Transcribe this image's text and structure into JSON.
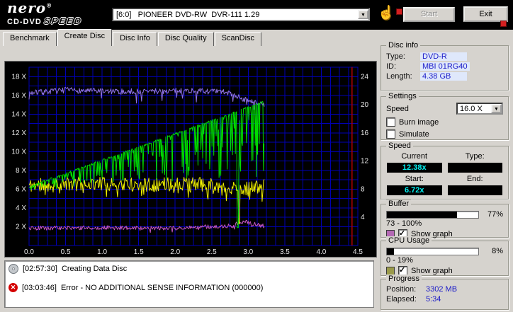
{
  "banner": {
    "logo_nero": "nero",
    "logo_reg": "®",
    "logo_sub1": "CD-DVD",
    "logo_sub2": "SPEED",
    "drive_selector": "[6:0]   PIONEER DVD-RW  DVR-111 1.29",
    "dropdown_glyph": "▼",
    "start_label": "Start",
    "exit_label": "Exit"
  },
  "tabs": [
    {
      "label": "Benchmark",
      "active": false
    },
    {
      "label": "Create Disc",
      "active": true
    },
    {
      "label": "Disc Info",
      "active": false
    },
    {
      "label": "Disc Quality",
      "active": false
    },
    {
      "label": "ScanDisc",
      "active": false
    }
  ],
  "chart_data": {
    "type": "line",
    "xlim": [
      0,
      4.5
    ],
    "ylim_left": [
      0,
      19
    ],
    "right_scale": 0.75,
    "x_ticks": [
      0,
      0.5,
      1,
      1.5,
      2,
      2.5,
      3,
      3.5,
      4,
      4.5
    ],
    "y_ticks_left": [
      {
        "v": 18,
        "label": "18 X"
      },
      {
        "v": 16,
        "label": "16 X"
      },
      {
        "v": 14,
        "label": "14 X"
      },
      {
        "v": 12,
        "label": "12 X"
      },
      {
        "v": 10,
        "label": "10 X"
      },
      {
        "v": 8,
        "label": "8 X"
      },
      {
        "v": 6,
        "label": "6 X"
      },
      {
        "v": 4,
        "label": "4 X"
      },
      {
        "v": 2,
        "label": "2 X"
      }
    ],
    "y_ticks_right": [
      {
        "v": 24,
        "label": "24"
      },
      {
        "v": 20,
        "label": "20"
      },
      {
        "v": 16,
        "label": "16"
      },
      {
        "v": 12,
        "label": "12"
      },
      {
        "v": 8,
        "label": "8"
      },
      {
        "v": 4,
        "label": "4"
      }
    ],
    "grid": {
      "color": "#0000b4",
      "x_step": 0.125,
      "y_step": 1
    },
    "end_marker": {
      "x": 4.42,
      "color": "#b40000"
    },
    "series": [
      {
        "name": "buffer-graph",
        "color": "#8f72e6",
        "seed": 7,
        "step": 0.01,
        "jitter": 0.3,
        "spike_prob": 0.07,
        "spike_depth": [
          0.4,
          1.8
        ],
        "keypoints": [
          [
            0,
            16.25
          ],
          [
            0.5,
            16.55
          ],
          [
            1.2,
            16.4
          ],
          [
            2.2,
            16.5
          ],
          [
            2.7,
            16.35
          ],
          [
            3.0,
            15.4
          ],
          [
            3.22,
            14.9
          ]
        ]
      },
      {
        "name": "aux-graph",
        "color": "#c255c2",
        "seed": 5,
        "step": 0.01,
        "jitter": 0.22,
        "spike_prob": 0.05,
        "spike_depth": [
          0.1,
          0.5
        ],
        "keypoints": [
          [
            0,
            1.85
          ],
          [
            1.0,
            1.9
          ],
          [
            2.0,
            1.85
          ],
          [
            2.75,
            2.1
          ],
          [
            2.95,
            2.6
          ],
          [
            3.1,
            2.25
          ],
          [
            3.22,
            2.05
          ]
        ]
      },
      {
        "name": "cpu-graph",
        "color": "#f2f200",
        "seed": 11,
        "step": 0.01,
        "jitter": 0.75,
        "spike_prob": 0.12,
        "spike_depth": [
          0.3,
          1.8
        ],
        "events": [
          {
            "x": 2.87,
            "y": 2.3,
            "w": 0.01
          }
        ],
        "keypoints": [
          [
            0,
            6.4
          ],
          [
            0.8,
            6.6
          ],
          [
            1.6,
            6.5
          ],
          [
            2.4,
            6.6
          ],
          [
            2.87,
            6.0
          ],
          [
            3.22,
            6.3
          ]
        ]
      },
      {
        "name": "write-speed-graph",
        "color": "#00dc00",
        "seed": 3,
        "step": 0.008,
        "jitter": 0.1,
        "spike_prob": 0.42,
        "spike_depth": [
          0.3,
          8.0
        ],
        "events": [
          {
            "x": 2.86,
            "y": 1.9,
            "w": 0.012
          }
        ],
        "keypoints": [
          [
            0,
            6.25
          ],
          [
            3.22,
            15.35
          ]
        ]
      }
    ]
  },
  "log": [
    {
      "time": "[02:57:30]",
      "text": "Creating Data Disc"
    },
    {
      "time": "[03:03:46]",
      "text": "Error - NO ADDITIONAL SENSE INFORMATION (000000)"
    }
  ],
  "disc_info": {
    "title": "Disc info",
    "type_label": "Type:",
    "type_value": "DVD-R",
    "id_label": "ID:",
    "id_value": "MBI 01RG40",
    "length_label": "Length:",
    "length_value": "4.38 GB"
  },
  "settings": {
    "title": "Settings",
    "speed_label": "Speed",
    "speed_value": "16.0 X",
    "dropdown_glyph": "▼",
    "burn_image_label": "Burn image",
    "burn_image_checked": false,
    "simulate_label": "Simulate",
    "simulate_checked": false
  },
  "speed": {
    "title": "Speed",
    "current_label": "Current",
    "type_label": "Type:",
    "current_value": "12.38x",
    "type_value": "",
    "start_label": "Start:",
    "end_label": "End:",
    "start_value": "6.72x",
    "end_value": ""
  },
  "buffer": {
    "title": "Buffer",
    "percent": 77,
    "percent_label": "77%",
    "range": "73 - 100%",
    "show_graph_label": "Show graph",
    "show_graph_checked": true,
    "swatch_color": "#b469b4"
  },
  "cpu": {
    "title": "CPU Usage",
    "percent": 8,
    "percent_label": "8%",
    "range": "0 - 19%",
    "show_graph_label": "Show graph",
    "show_graph_checked": true,
    "swatch_color": "#9a9a4a"
  },
  "progress": {
    "title": "Progress",
    "position_label": "Position:",
    "position_value": "3302 MB",
    "elapsed_label": "Elapsed:",
    "elapsed_value": "5:34"
  }
}
